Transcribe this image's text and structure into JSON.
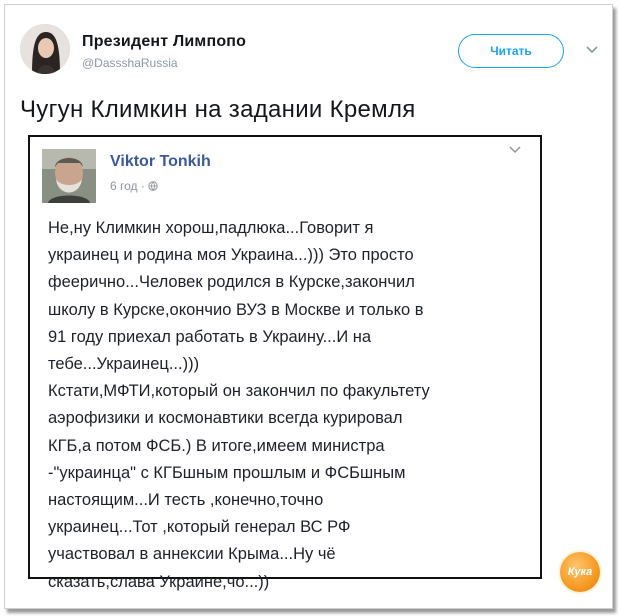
{
  "tweet": {
    "author_name": "Президент Лимпопо",
    "author_handle": "@DassshaRussia",
    "follow_label": "Читать",
    "text": "Чугун Климкин на задании Кремля"
  },
  "facebook_post": {
    "author": "Viktor  Tonkih",
    "time": "6 год",
    "separator": "·",
    "body_lines": [
      "Не,ну Климкин хорош,падлюка...Говорит я",
      "украинец и родина моя Украина...))) Это просто",
      "феерично...Человек родился в Курске,закончил",
      "школу в Курске,окончио ВУЗ в Москве и только в",
      "91 году приехал работать в Украину...И на",
      "тебе...Украинец...)))",
      "Кстати,МФТИ,который он закончил по факультету",
      "аэрофизики и космонавтики всегда курировал",
      "КГБ,а потом ФСБ.) В итоге,имеем министра",
      "-\"украинца\" с КГБшным прошлым и ФСБшным",
      "настоящим...И тесть ,конечно,точно",
      "украинец...Тот ,который генерал ВС РФ",
      "участвовал в аннексии Крыма...Ну чё",
      "сказать,слава Украине,чо...))"
    ]
  },
  "watermark": {
    "text": "Кука"
  },
  "colors": {
    "accent": "#1da1f2",
    "fb_blue": "#3b5998",
    "badge": "#f59a23"
  },
  "icons": [
    "avatar",
    "chevron-down-icon",
    "globe-icon",
    "watermark-badge"
  ]
}
